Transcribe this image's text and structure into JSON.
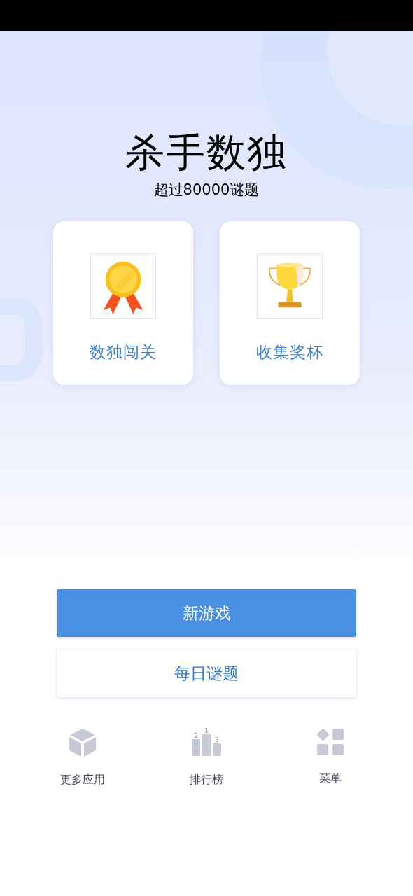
{
  "title": "杀手数独",
  "subtitle": "超过80000谜题",
  "cards": [
    {
      "kind": "medal",
      "label": "数独闯关"
    },
    {
      "kind": "trophy",
      "label": "收集奖杯"
    }
  ],
  "buttons": [
    {
      "kind": "primary",
      "label": "新游戏"
    },
    {
      "kind": "secondary",
      "label": "每日谜题"
    }
  ],
  "bottom_nav": [
    {
      "kind": "cube",
      "label": "更多应用"
    },
    {
      "kind": "podium",
      "label": "排行榜",
      "rank_labels": [
        "2",
        "1",
        "3"
      ]
    },
    {
      "kind": "grid",
      "label": "菜单"
    }
  ]
}
